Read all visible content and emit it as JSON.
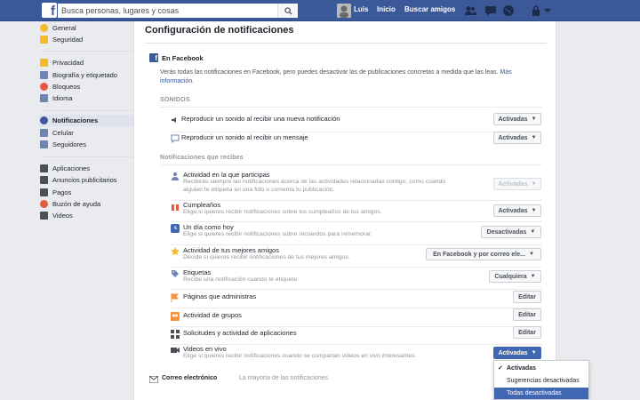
{
  "topbar": {
    "search_placeholder": "Busca personas, lugares y cosas",
    "user_name": "Luis",
    "home": "Inicio",
    "find_friends": "Buscar amigos"
  },
  "left_nav": {
    "group1": [
      {
        "label": "General",
        "icon": "gear-icon",
        "color": "#f7b928"
      },
      {
        "label": "Seguridad",
        "icon": "shield-icon",
        "color": "#f7b928"
      }
    ],
    "group2": [
      {
        "label": "Privacidad",
        "icon": "lock-icon",
        "color": "#f7b928"
      },
      {
        "label": "Biografía y etiquetado",
        "icon": "timeline-icon",
        "color": "#6d84b4"
      },
      {
        "label": "Bloqueos",
        "icon": "block-icon",
        "color": "#e9573f"
      },
      {
        "label": "Idioma",
        "icon": "language-icon",
        "color": "#6d84b4"
      }
    ],
    "group3": [
      {
        "label": "Notificaciones",
        "icon": "globe-icon",
        "color": "#3b5998",
        "active": true
      },
      {
        "label": "Celular",
        "icon": "mobile-icon",
        "color": "#6d84b4"
      },
      {
        "label": "Seguidores",
        "icon": "rss-icon",
        "color": "#6d84b4"
      }
    ],
    "group4": [
      {
        "label": "Aplicaciones",
        "icon": "apps-icon",
        "color": "#4b4f56"
      },
      {
        "label": "Anuncios publicitarios",
        "icon": "ads-icon",
        "color": "#4b4f56"
      },
      {
        "label": "Pagos",
        "icon": "payments-icon",
        "color": "#4b4f56"
      },
      {
        "label": "Buzón de ayuda",
        "icon": "lifebuoy-icon",
        "color": "#e9573f"
      },
      {
        "label": "Videos",
        "icon": "video-icon",
        "color": "#4b4f56"
      }
    ]
  },
  "main": {
    "title": "Configuración de notificaciones",
    "section": "En Facebook",
    "intro": "Verás todas las notificaciones en Facebook, pero puedes desactivar las de publicaciones concretas a medida que las leas.",
    "intro_link": "Más información.",
    "sounds_heading": "SONIDOS",
    "sounds": [
      {
        "label": "Reproducir un sonido al recibir una nueva notificación",
        "value": "Activadas",
        "icon": "speaker-icon"
      },
      {
        "label": "Reproducir un sonido al recibir un mensaje",
        "value": "Activadas",
        "icon": "message-icon"
      }
    ],
    "notif_heading": "Notificaciones que recibes",
    "rows": [
      {
        "title": "Actividad en la que participas",
        "desc1": "Recibirás siempre las notificaciones acerca de las actividades relacionadas contigo, como cuando",
        "desc2": "alguien te etiqueta en una foto o comenta tu publicación.",
        "value": "Activadas",
        "icon": "person-icon",
        "disabled": true
      },
      {
        "title": "Cumpleaños",
        "desc1": "Elige si quieres recibir notificaciones sobre los cumpleaños de tus amigos.",
        "value": "Activadas",
        "icon": "gift-icon"
      },
      {
        "title": "Un día como hoy",
        "desc1": "Elige si quieres recibir notificaciones sobre recuerdos para rememorar.",
        "value": "Desactivadas",
        "icon": "clock-icon"
      },
      {
        "title": "Actividad de tus mejores amigos",
        "desc1": "Decide si quieres recibir notificaciones de tus mejores amigos.",
        "value": "En Facebook y por correo ele...",
        "icon": "star-icon"
      },
      {
        "title": "Etiquetas",
        "desc1": "Recibe una notificación cuando te etiquete:",
        "value": "Cualquiera",
        "icon": "tag-icon"
      },
      {
        "title": "Páginas que administras",
        "value": "Editar",
        "icon": "flag-icon",
        "edit": true
      },
      {
        "title": "Actividad de grupos",
        "value": "Editar",
        "icon": "groups-icon",
        "edit": true
      },
      {
        "title": "Solicitudes y actividad de aplicaciones",
        "value": "Editar",
        "icon": "apps-icon",
        "edit": true
      },
      {
        "title": "Videos en vivo",
        "desc1": "Elige si quieres recibir notificaciones cuando se compartan videos en vivo interesantes.",
        "value": "Activadas",
        "icon": "live-video-icon",
        "open": true
      }
    ],
    "dropdown": {
      "options": [
        "Activadas",
        "Sugerencias desactivadas",
        "Todas desactivadas"
      ],
      "checked": 0,
      "highlighted": 2
    },
    "email": {
      "label": "Correo electrónico",
      "value": "La mayoría de las notificaciones"
    }
  }
}
